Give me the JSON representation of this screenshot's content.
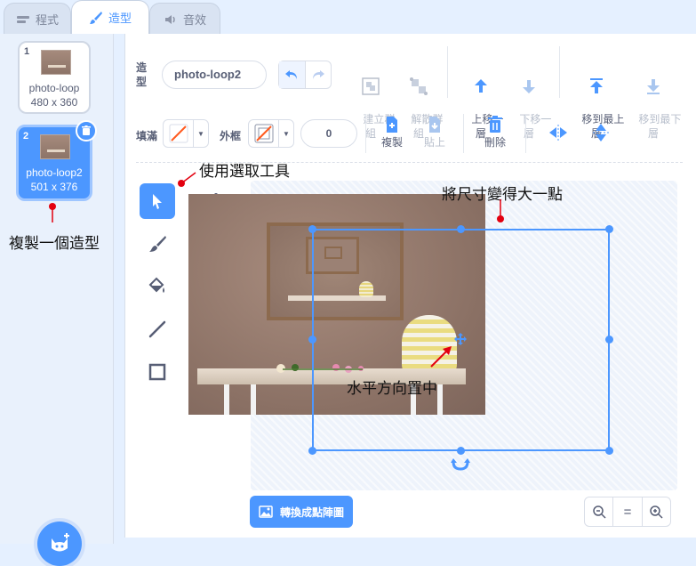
{
  "tabs": [
    {
      "label": "程式",
      "icon": "code-icon"
    },
    {
      "label": "造型",
      "icon": "brush-icon",
      "active": true
    },
    {
      "label": "音效",
      "icon": "speaker-icon"
    }
  ],
  "costumes": [
    {
      "number": "1",
      "name": "photo-loop",
      "size": "480 x 360"
    },
    {
      "number": "2",
      "name": "photo-loop2",
      "size": "501 x 376",
      "selected": true
    }
  ],
  "toolbar": {
    "costume_label": "造\n型",
    "costume_name": "photo-loop2",
    "group": "建立群\n組",
    "ungroup": "解散群\n組",
    "forward": "上移一\n層",
    "backward": "下移一\n層",
    "front": "移到最上\n層",
    "back": "移到最下\n層",
    "fill_label": "填滿",
    "outline_label": "外框",
    "outline_width": "0",
    "copy": "複製",
    "paste": "貼上",
    "delete": "刪除"
  },
  "convert_button": "轉換成點陣圖",
  "zoom": {
    "out": "-",
    "reset": "=",
    "in": "+"
  },
  "annotations": {
    "select_tool": "使用選取工具",
    "resize": "將尺寸變得大一點",
    "copy_costume": "複製一個造型",
    "center": "水平方向置中"
  },
  "colors": {
    "accent": "#4c97ff",
    "annotation": "#e3000f"
  }
}
